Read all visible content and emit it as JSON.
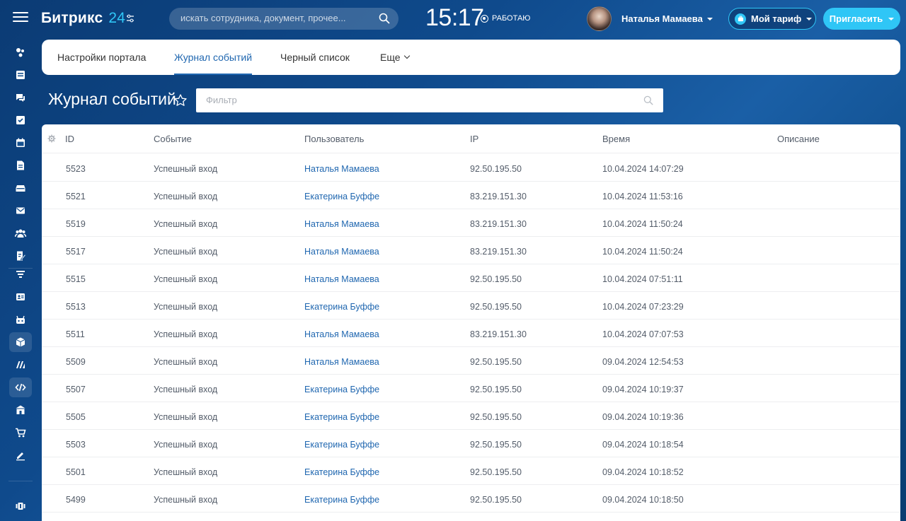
{
  "header": {
    "logo_main": "Битрикс",
    "logo_num": "24",
    "search_placeholder": "искать сотрудника, документ, прочее...",
    "clock": "15:17",
    "work_status": "РАБОТАЮ",
    "user_name": "Наталья Мамаева",
    "tariff_label": "Мой тариф",
    "invite_label": "Пригласить"
  },
  "tabs": [
    {
      "label": "Настройки портала",
      "active": false
    },
    {
      "label": "Журнал событий",
      "active": true
    },
    {
      "label": "Черный список",
      "active": false
    },
    {
      "label": "Еще",
      "active": false
    }
  ],
  "page": {
    "title": "Журнал событий",
    "filter_placeholder": "Фильтр"
  },
  "table": {
    "columns": [
      "ID",
      "Событие",
      "Пользователь",
      "IP",
      "Время",
      "Описание"
    ],
    "rows": [
      {
        "id": "5523",
        "event": "Успешный вход",
        "user": "Наталья Мамаева",
        "ip": "92.50.195.50",
        "time": "10.04.2024 14:07:29"
      },
      {
        "id": "5521",
        "event": "Успешный вход",
        "user": "Екатерина Буффе",
        "ip": "83.219.151.30",
        "time": "10.04.2024 11:53:16"
      },
      {
        "id": "5519",
        "event": "Успешный вход",
        "user": "Наталья Мамаева",
        "ip": "83.219.151.30",
        "time": "10.04.2024 11:50:24"
      },
      {
        "id": "5517",
        "event": "Успешный вход",
        "user": "Наталья Мамаева",
        "ip": "83.219.151.30",
        "time": "10.04.2024 11:50:24"
      },
      {
        "id": "5515",
        "event": "Успешный вход",
        "user": "Наталья Мамаева",
        "ip": "92.50.195.50",
        "time": "10.04.2024 07:51:11"
      },
      {
        "id": "5513",
        "event": "Успешный вход",
        "user": "Екатерина Буффе",
        "ip": "92.50.195.50",
        "time": "10.04.2024 07:23:29"
      },
      {
        "id": "5511",
        "event": "Успешный вход",
        "user": "Наталья Мамаева",
        "ip": "83.219.151.30",
        "time": "10.04.2024 07:07:53"
      },
      {
        "id": "5509",
        "event": "Успешный вход",
        "user": "Наталья Мамаева",
        "ip": "92.50.195.50",
        "time": "09.04.2024 12:54:53"
      },
      {
        "id": "5507",
        "event": "Успешный вход",
        "user": "Екатерина Буффе",
        "ip": "92.50.195.50",
        "time": "09.04.2024 10:19:37"
      },
      {
        "id": "5505",
        "event": "Успешный вход",
        "user": "Екатерина Буффе",
        "ip": "92.50.195.50",
        "time": "09.04.2024 10:19:36"
      },
      {
        "id": "5503",
        "event": "Успешный вход",
        "user": "Екатерина Буффе",
        "ip": "92.50.195.50",
        "time": "09.04.2024 10:18:54"
      },
      {
        "id": "5501",
        "event": "Успешный вход",
        "user": "Екатерина Буффе",
        "ip": "92.50.195.50",
        "time": "09.04.2024 10:18:52"
      },
      {
        "id": "5499",
        "event": "Успешный вход",
        "user": "Екатерина Буффе",
        "ip": "92.50.195.50",
        "time": "09.04.2024 10:18:50"
      }
    ]
  },
  "sidebar": {
    "icons": [
      "activity-stream-icon",
      "feed-icon",
      "chat-icon",
      "tasks-icon",
      "calendar-icon",
      "documents-icon",
      "drive-icon",
      "mail-icon",
      "employees-icon",
      "workflows-icon",
      "filter-icon",
      "contact-center-icon",
      "robots-icon",
      "market-icon",
      "marketing-icon",
      "developer-icon",
      "company-icon",
      "shop-icon",
      "sign-icon",
      "bottom-tools-icon"
    ]
  },
  "colors": {
    "accent": "#2fc6f6",
    "link": "#2067b0",
    "background": "#0f4a8c"
  }
}
